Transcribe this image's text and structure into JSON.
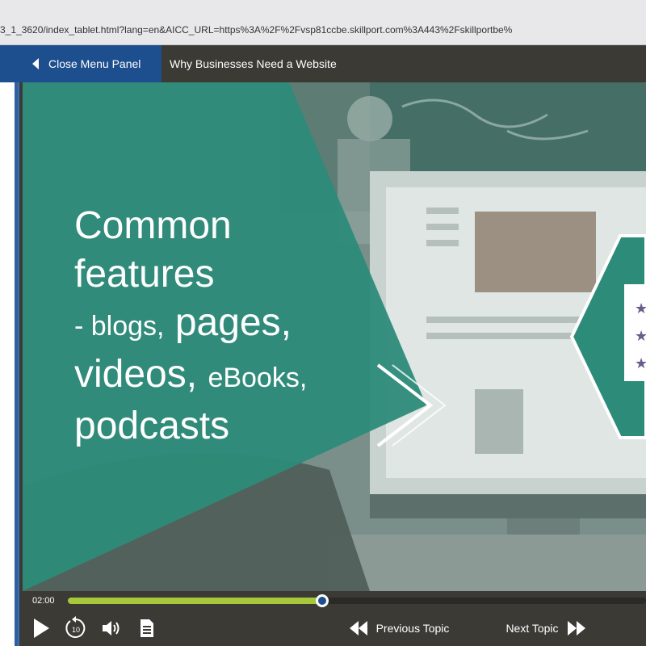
{
  "browser": {
    "url": "3_1_3620/index_tablet.html?lang=en&AICC_URL=https%3A%2F%2Fvsp81ccbe.skillport.com%3A443%2Fskillportbe%"
  },
  "header": {
    "close_menu_label": "Close Menu Panel",
    "course_title": "Why Businesses Need a Website"
  },
  "slide": {
    "line1": "Common",
    "line2": "features",
    "line3_dash": "- blogs,",
    "line3_big": "pages,",
    "line4_big": "videos,",
    "line4_small": "eBooks,",
    "line5": "podcasts"
  },
  "player": {
    "time": "02:00",
    "progress": 0.44,
    "replay_label": "10",
    "previous_topic": "Previous Topic",
    "next_topic": "Next Topic"
  },
  "colors": {
    "teal": "#2d8b79",
    "progress": "#a6c83a",
    "accent_blue": "#1d4e8e"
  }
}
